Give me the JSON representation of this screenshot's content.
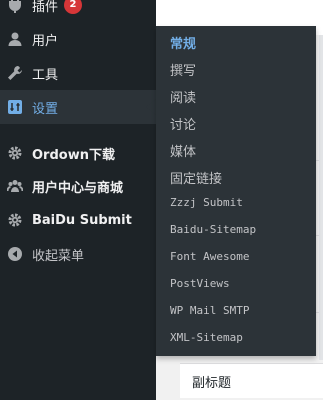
{
  "sidebar": {
    "items": [
      {
        "label": "插件",
        "badge": "2",
        "icon": "plug-icon"
      },
      {
        "label": "用户",
        "icon": "user-icon"
      },
      {
        "label": "工具",
        "icon": "wrench-icon"
      },
      {
        "label": "设置",
        "icon": "settings-icon",
        "current": true
      },
      {
        "label": "Ordown下载",
        "icon": "gear-icon"
      },
      {
        "label": "用户中心与商城",
        "icon": "users-icon"
      },
      {
        "label": "BaiDu Submit",
        "icon": "gear-icon"
      },
      {
        "label": "收起菜单",
        "icon": "collapse-icon"
      }
    ]
  },
  "submenu": {
    "items": [
      "常规",
      "撰写",
      "阅读",
      "讨论",
      "媒体",
      "固定链接",
      "Zzzj Submit",
      "Baidu-Sitemap",
      "Font Awesome",
      "PostViews",
      "WP Mail SMTP",
      "XML-Sitemap"
    ]
  },
  "content": {
    "field_label": "副标题"
  },
  "colors": {
    "sidebar_bg": "#1d2327",
    "submenu_bg": "#2c3338",
    "accent": "#72aee6",
    "badge": "#d63638"
  }
}
